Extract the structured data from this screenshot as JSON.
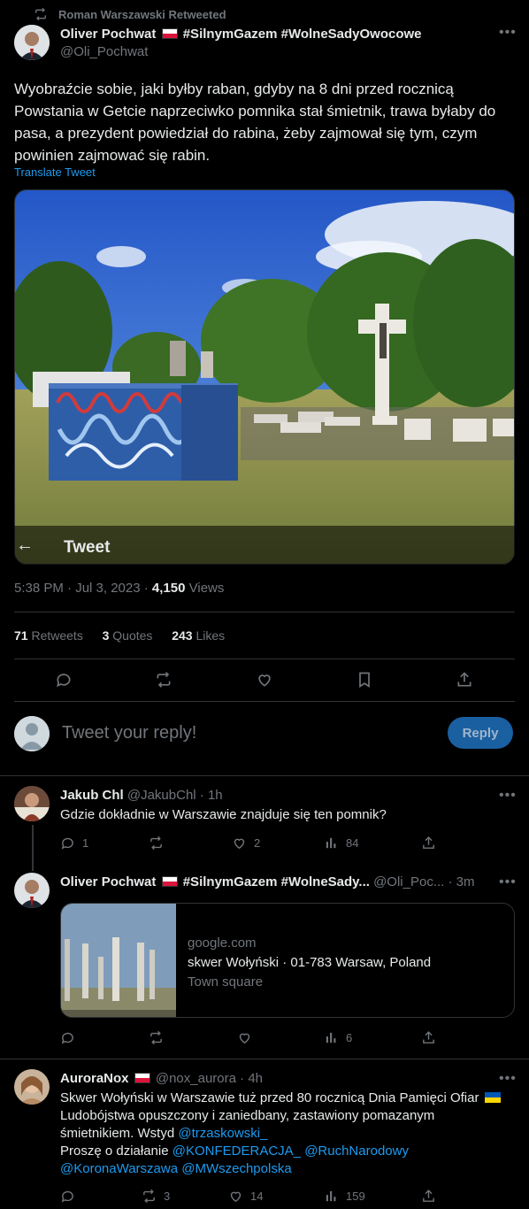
{
  "retweet_notice": "Roman Warszawski Retweeted",
  "main": {
    "author_name": "Oliver Pochwat",
    "author_hashtags": "#SilnymGazem #WolneSadyOwocowe",
    "handle": "@Oli_Pochwat",
    "text": "Wyobraźcie sobie, jaki byłby raban, gdyby na 8 dni przed rocznicą Powstania w Getcie naprzeciwko pomnika stał śmietnik, trawa byłaby do pasa, a prezydent powiedział do rabina, żeby zajmował się tym, czym powinien zajmować się rabin.",
    "translate": "Translate Tweet",
    "overlay_back": "←",
    "overlay_title": "Tweet",
    "time": "5:38 PM · Jul 3, 2023 · ",
    "views_count": "4,150",
    "views_label": " Views",
    "retweets_count": "71",
    "retweets_label": " Retweets",
    "quotes_count": "3",
    "quotes_label": " Quotes",
    "likes_count": "243",
    "likes_label": " Likes"
  },
  "reply_box": {
    "placeholder": "Tweet your reply!",
    "button": "Reply"
  },
  "replies": [
    {
      "name": "Jakub Chl",
      "handle": "@JakubChl",
      "time": " · 1h",
      "text": "Gdzie dokładnie w Warszawie znajduje się ten pomnik?",
      "replies": "1",
      "retweets": "",
      "likes": "2",
      "views": "84"
    },
    {
      "name": "Oliver Pochwat",
      "hashtags": "#SilnymGazem #WolneSady...",
      "handle": "@Oli_Poc...",
      "time": " · 3m",
      "card_domain": "google.com",
      "card_title": "skwer Wołyński · 01-783 Warsaw, Poland",
      "card_subtitle": "Town square",
      "views": "6"
    },
    {
      "name": "AuroraNox",
      "handle": "@nox_aurora",
      "time": " · 4h",
      "line1a": "Skwer Wołyński w Warszawie tuż przed 80 rocznicą Dnia Pamięci Ofiar",
      "line2": "Ludobójstwa opuszczony i zaniedbany, zastawiony pomazanym",
      "line3a": "śmietnikiem. Wstyd ",
      "mention1": "@trzaskowski_",
      "line4a": "Proszę o działanie ",
      "mention2": "@KONFEDERACJA_",
      "mention3": "@RuchNarodowy",
      "mention4": "@KoronaWarszawa",
      "mention5": "@MWszechpolska",
      "retweets": "3",
      "likes": "14",
      "views": "159"
    }
  ],
  "colors": {
    "accent": "#1d9bf0",
    "muted": "#71767b",
    "divider": "#2f3336",
    "reply_button": "#1a5fa0"
  }
}
